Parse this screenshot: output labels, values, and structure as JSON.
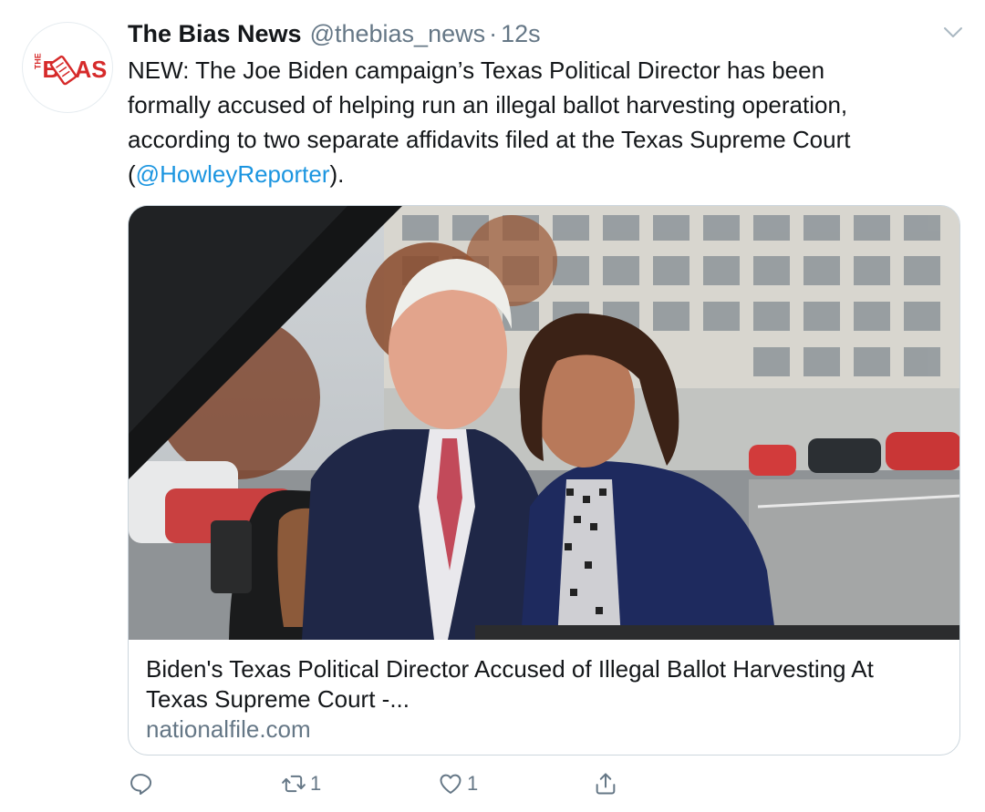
{
  "tweet": {
    "avatar_text": "THE BIAS",
    "display_name": "The Bias News",
    "handle": "@thebias_news",
    "separator": "·",
    "time": "12s",
    "body_line_1": "NEW: The Joe Biden campaign’s Texas Political Director has been",
    "body_line_2": "formally accused of helping run an illegal ballot harvesting operation,",
    "body_line_3": "according to two separate affidavits filed at the Texas Supreme Court",
    "body_open": "(",
    "body_mention": "@HowleyReporter",
    "body_close": ")."
  },
  "card": {
    "image_alt": "Photo of Joe Biden and Kamala Harris posing outside a car window",
    "title_line_1": "Biden's Texas Political Director Accused of Illegal Ballot Harvesting At",
    "title_line_2": "Texas Supreme Court -...",
    "domain": "nationalfile.com"
  },
  "actions": {
    "reply_count": "",
    "retweet_count": "1",
    "like_count": "1"
  },
  "icons": {
    "caret": "chevron-down-icon",
    "reply": "reply-icon",
    "retweet": "retweet-icon",
    "like": "heart-icon",
    "share": "share-icon"
  },
  "colors": {
    "link": "#1b95e0",
    "secondary": "#657786",
    "text": "#14171a",
    "border": "#ccd6dd",
    "brand_red": "#d62a2a"
  }
}
